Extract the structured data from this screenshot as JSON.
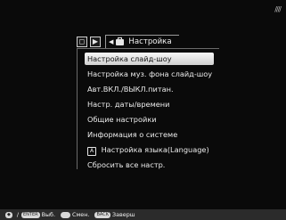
{
  "status": {
    "signal_text": "////"
  },
  "tabs": {
    "icon1": "◻",
    "icon2": "▶",
    "settings_label": "Настройка"
  },
  "menu": {
    "items": [
      {
        "label": "Настройка слайд-шоу",
        "selected": true
      },
      {
        "label": "Настройка муз. фона слайд-шоу"
      },
      {
        "label": "Авт.ВКЛ./ВЫКЛ.питан."
      },
      {
        "label": "Настр. даты/времени"
      },
      {
        "label": "Общие настройки"
      },
      {
        "label": "Информация о системе"
      },
      {
        "label": "Настройка языка(Language)",
        "badge": "A"
      },
      {
        "label": "Сбросить все настр."
      }
    ]
  },
  "footer": {
    "nav_key": "◆",
    "enter_key": "ENTER",
    "select_label": "Выб.",
    "change_label": "Смен.",
    "back_key": "BACK",
    "finish_label": "Заверш"
  },
  "colors": {
    "background": "#0a0a0a",
    "highlight": "#e8e8e8",
    "footer_bg": "#2b2b2b"
  }
}
